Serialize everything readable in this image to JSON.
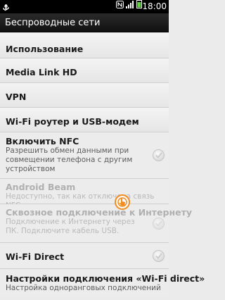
{
  "status_bar": {
    "time": "18:00",
    "icons": [
      "usb-icon",
      "nfc-icon",
      "signal-icon",
      "battery-icon"
    ]
  },
  "header": {
    "title": "Беспроводные сети"
  },
  "items": [
    {
      "title": "Использование"
    },
    {
      "title": "Media Link HD"
    },
    {
      "title": "VPN"
    },
    {
      "title": "Wi-Fi роутер и USB-модем"
    },
    {
      "title": "Включить NFC",
      "subtitle": "Разрешить обмен данными при совмещении телефона с другим устройством",
      "checkbox": "unchecked"
    },
    {
      "title": "Android Beam",
      "subtitle": "Недоступно, так как отключена связь NFC",
      "disabled": true
    },
    {
      "title": "Сквозное подключение к Интернету",
      "subtitle": "Подключение к Интернету через ПК. Подключите кабель USB.",
      "checkbox": "unchecked",
      "disabled": true
    },
    {
      "title": "Wi-Fi Direct",
      "checkbox": "unchecked"
    },
    {
      "title": "Настройки подключения «Wi-Fi direct»",
      "subtitle": "Настройка одноранговых подключений"
    }
  ],
  "colors": {
    "background": "#ebebeb",
    "title_bar": "#1a1a1a",
    "disabled_text": "#b0b0b0",
    "touch_pointer": "#f28c1e"
  }
}
